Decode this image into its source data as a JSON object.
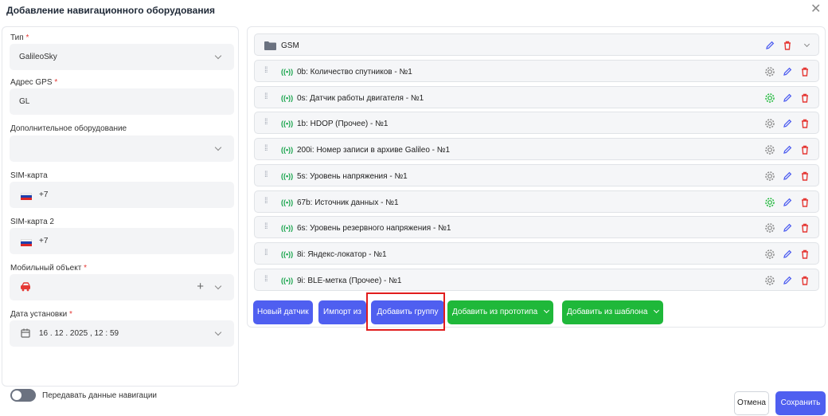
{
  "dialog": {
    "title": "Добавление навигационного оборудования"
  },
  "form": {
    "type_label": "Тип",
    "type_value": "GalileoSky",
    "gps_label": "Адрес GPS",
    "gps_value": "GL",
    "extra_label": "Дополнительное оборудование",
    "extra_value": "",
    "sim1_label": "SIM-карта",
    "sim1_code": "+7",
    "sim2_label": "SIM-карта 2",
    "sim2_code": "+7",
    "mobile_label": "Мобильный объект",
    "date_label": "Дата установки",
    "date_value": "16 . 12 . 2025 , 12 : 59",
    "toggle_label": "Передавать данные навигации",
    "toggle_on": false
  },
  "group": {
    "name": "GSM"
  },
  "sensors": [
    {
      "label": "0b: Количество спутников - №1",
      "active": false
    },
    {
      "label": "0s: Датчик работы двигателя - №1",
      "active": true
    },
    {
      "label": "1b: HDOP (Прочее) - №1",
      "active": false
    },
    {
      "label": "200i: Номер записи в архиве Galileo - №1",
      "active": false
    },
    {
      "label": "5s: Уровень напряжения - №1",
      "active": false
    },
    {
      "label": "67b: Источник данных - №1",
      "active": true
    },
    {
      "label": "6s: Уровень резервного напряжения - №1",
      "active": false
    },
    {
      "label": "8i: Яндекс-локатор - №1",
      "active": false
    },
    {
      "label": "9i: BLE-метка (Прочее) - №1",
      "active": false
    }
  ],
  "signal_glyph": "((•))",
  "actions": {
    "new_sensor": "Новый датчик",
    "import": "Импорт из",
    "add_group": "Добавить группу",
    "from_prototype": "Добавить из прототипа",
    "from_template": "Добавить из шаблона"
  },
  "footer": {
    "cancel": "Отмена",
    "save": "Сохранить"
  },
  "colors": {
    "accent": "#4f5ff0",
    "green": "#1fb83a",
    "danger": "#e53935",
    "highlight": "#e11d1d"
  },
  "icons": [
    "close-icon",
    "chevron-down-icon",
    "folder-icon",
    "drag-handle-icon",
    "signal-icon",
    "gear-icon",
    "pencil-icon",
    "trash-icon",
    "calendar-icon",
    "car-icon",
    "plus-icon"
  ]
}
